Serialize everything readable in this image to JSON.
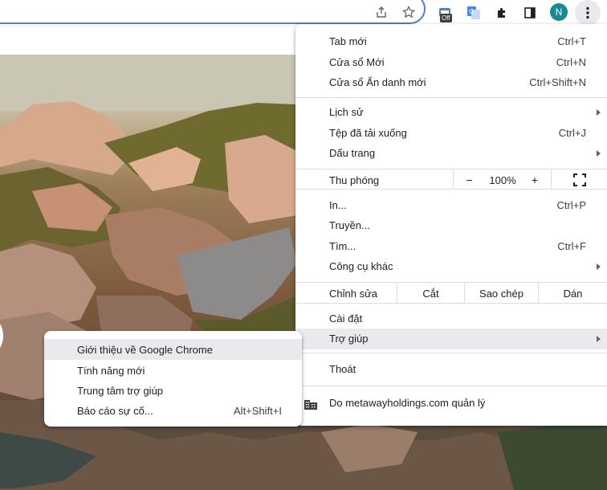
{
  "toolbar": {
    "extension_badge": "Off",
    "avatar_letter": "N",
    "icons": [
      "share-icon",
      "bookmark-star-icon",
      "tab-search-extension-icon",
      "google-translate-icon",
      "extensions-puzzle-icon",
      "side-panel-icon",
      "profile-avatar",
      "more-vert-icon"
    ]
  },
  "menu": {
    "new_tab": {
      "label": "Tab mới",
      "shortcut": "Ctrl+T"
    },
    "new_window": {
      "label": "Cửa sổ Mới",
      "shortcut": "Ctrl+N"
    },
    "incognito": {
      "label": "Cửa sổ Ẩn danh mới",
      "shortcut": "Ctrl+Shift+N"
    },
    "history": {
      "label": "Lịch sử"
    },
    "downloads": {
      "label": "Tệp đã tải xuống",
      "shortcut": "Ctrl+J"
    },
    "bookmarks": {
      "label": "Dấu trang"
    },
    "zoom": {
      "label": "Thu phóng",
      "minus": "−",
      "value": "100%",
      "plus": "+"
    },
    "print": {
      "label": "In...",
      "shortcut": "Ctrl+P"
    },
    "cast": {
      "label": "Truyền..."
    },
    "find": {
      "label": "Tìm...",
      "shortcut": "Ctrl+F"
    },
    "more_tools": {
      "label": "Công cụ khác"
    },
    "edit": {
      "label": "Chỉnh sửa",
      "cut": "Cắt",
      "copy": "Sao chép",
      "paste": "Dán"
    },
    "settings": {
      "label": "Cài đặt"
    },
    "help": {
      "label": "Trợ giúp"
    },
    "exit": {
      "label": "Thoát"
    },
    "managed": {
      "label": "Do metawayholdings.com quản lý"
    }
  },
  "help_submenu": {
    "about": {
      "label": "Giới thiệu về Google Chrome"
    },
    "whats_new": {
      "label": "Tính năng mới"
    },
    "help_center": {
      "label": "Trung tâm trợ giúp"
    },
    "report_issue": {
      "label": "Báo cáo sự cố...",
      "shortcut": "Alt+Shift+I"
    }
  },
  "colors": {
    "accent": "#4a7fd3",
    "avatar": "#1a8a91",
    "hover": "#e8eaed"
  }
}
